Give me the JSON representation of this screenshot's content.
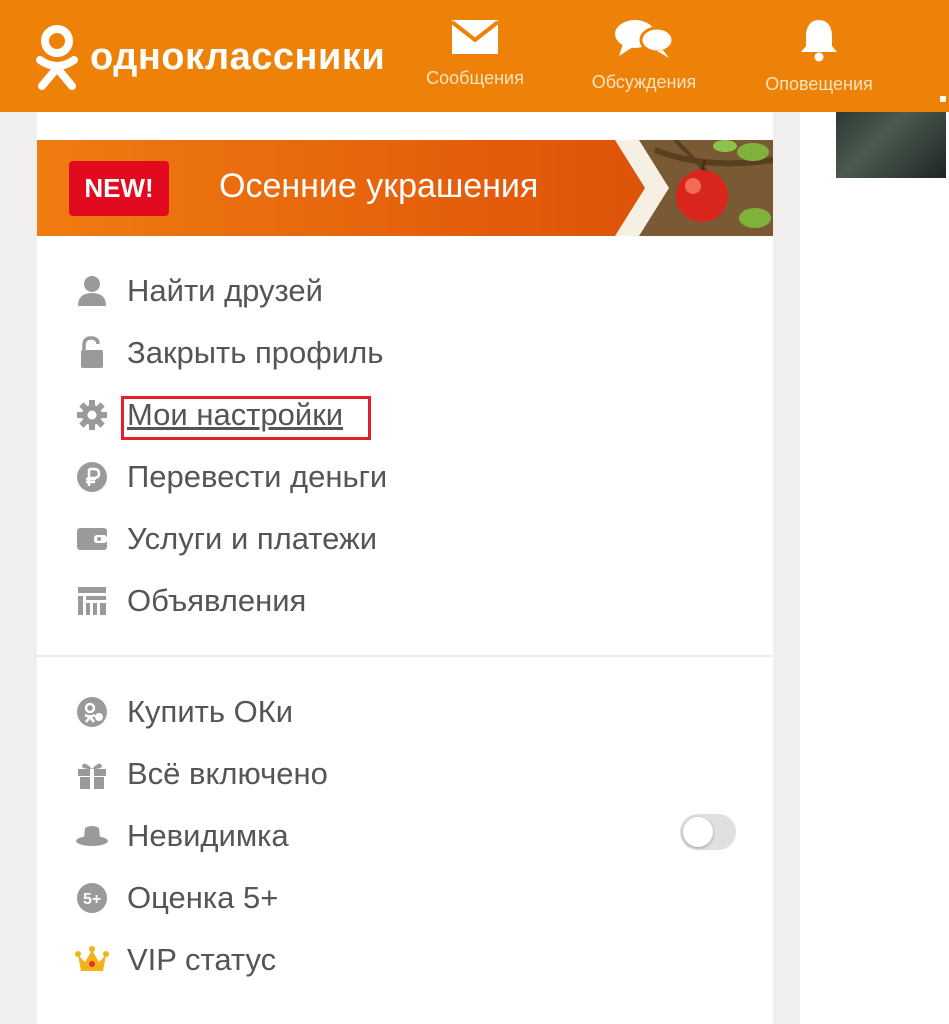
{
  "header": {
    "brand": "одноклассники",
    "nav": [
      {
        "label": "Сообщения",
        "icon": "envelope-icon"
      },
      {
        "label": "Обсуждения",
        "icon": "chat-bubbles-icon"
      },
      {
        "label": "Оповещения",
        "icon": "bell-icon"
      }
    ],
    "colors": {
      "accent": "#ee8208"
    }
  },
  "banner": {
    "badge": "NEW!",
    "title": "Осенние украшения",
    "colors": {
      "badge": "#e20a1e"
    }
  },
  "menu_primary": [
    {
      "label": "Найти друзей",
      "icon": "person-icon"
    },
    {
      "label": "Закрыть профиль",
      "icon": "unlocked-padlock-icon"
    },
    {
      "label": "Мои настройки",
      "icon": "gear-icon",
      "highlighted": true
    },
    {
      "label": "Перевести деньги",
      "icon": "ruble-icon"
    },
    {
      "label": "Услуги и платежи",
      "icon": "wallet-icon"
    },
    {
      "label": "Объявления",
      "icon": "ads-board-icon"
    }
  ],
  "menu_secondary": [
    {
      "label": "Купить ОКи",
      "icon": "ok-coin-icon"
    },
    {
      "label": "Всё включено",
      "icon": "gift-icon"
    },
    {
      "label": "Невидимка",
      "icon": "hat-icon",
      "toggle": "off"
    },
    {
      "label": "Оценка 5+",
      "icon": "five-plus-icon"
    },
    {
      "label": "VIP статус",
      "icon": "crown-icon"
    }
  ]
}
